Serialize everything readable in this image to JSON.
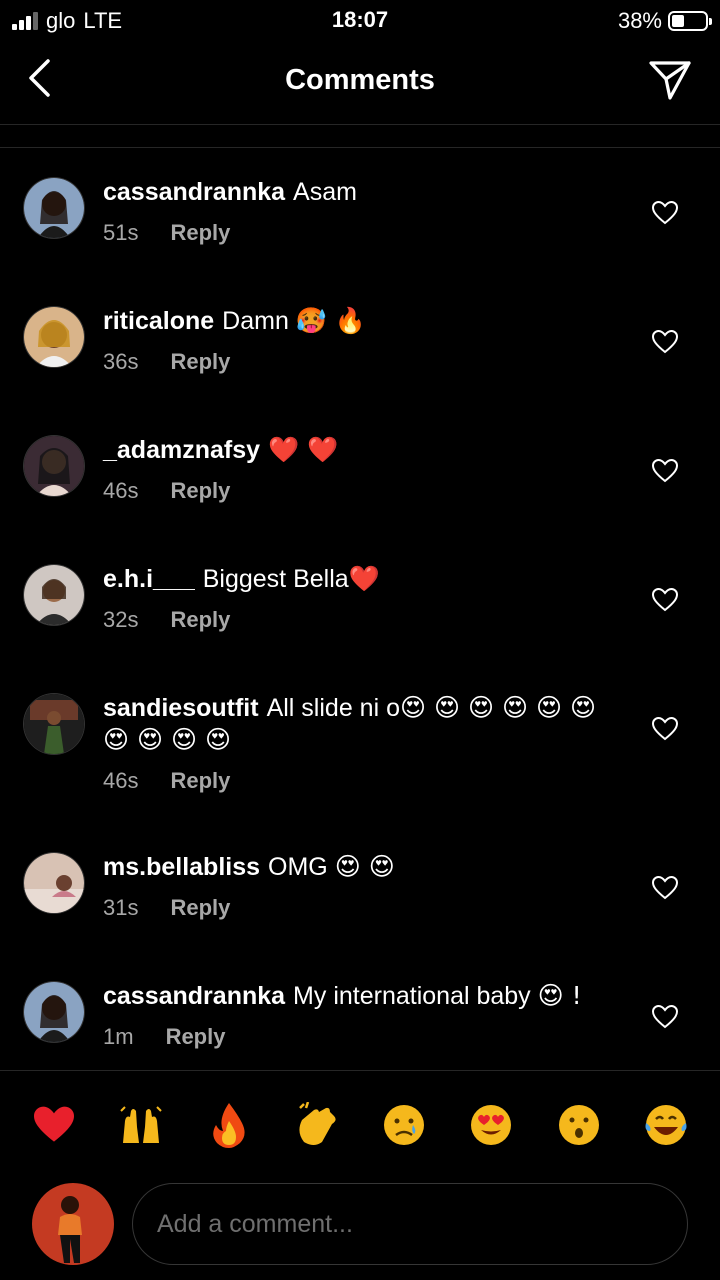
{
  "status_bar": {
    "carrier": "glo",
    "network": "LTE",
    "time": "18:07",
    "battery_percent": "38%",
    "battery_level": 0.38
  },
  "header": {
    "title": "Comments",
    "back_icon": "chevron-left-icon",
    "send_icon": "paper-plane-icon"
  },
  "comments": [
    {
      "username": "cassandrannka",
      "text": "Asam",
      "emojis": "",
      "time": "51s",
      "reply_label": "Reply"
    },
    {
      "username": "riticalone",
      "text": "Damn",
      "emojis": "🥵 🔥",
      "time": "36s",
      "reply_label": "Reply"
    },
    {
      "username": "_adamznafsy",
      "text": "",
      "emojis": "❤️ ❤️",
      "time": "46s",
      "reply_label": "Reply"
    },
    {
      "username": "e.h.i___",
      "text": "Biggest Bella",
      "emojis": "❤️",
      "time": "32s",
      "reply_label": "Reply"
    },
    {
      "username": "sandiesoutfit",
      "text": "All slide ni o",
      "emojis": "😍 😍 😍 😍 😍 😍 😍 😍 😍 😍",
      "time": "46s",
      "reply_label": "Reply"
    },
    {
      "username": "ms.bellabliss",
      "text": "OMG",
      "emojis": "😍 😍",
      "time": "31s",
      "reply_label": "Reply"
    },
    {
      "username": "cassandrannka",
      "text": "My international baby",
      "emojis": "😍 !",
      "time": "1m",
      "reply_label": "Reply"
    }
  ],
  "quick_reactions": [
    "❤️",
    "🙌",
    "🔥",
    "👏",
    "😢",
    "😍",
    "😮",
    "😂"
  ],
  "composer": {
    "placeholder": "Add a comment..."
  },
  "colors": {
    "background": "#000000",
    "text": "#ffffff",
    "secondary_text": "#a8a8a8",
    "divider": "#262626"
  }
}
